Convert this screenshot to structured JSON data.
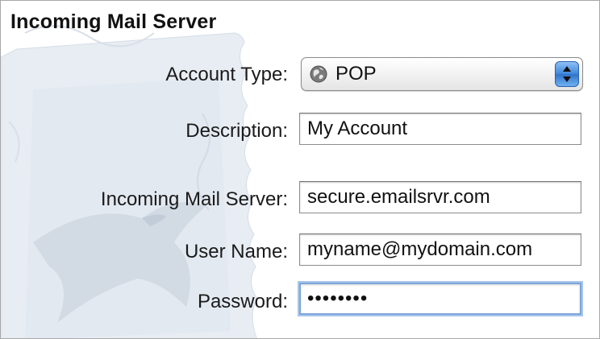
{
  "section": {
    "title": "Incoming Mail Server"
  },
  "form": {
    "account_type": {
      "label": "Account Type:",
      "value": "POP",
      "icon": "globe-icon"
    },
    "description": {
      "label": "Description:",
      "value": "My Account"
    },
    "incoming_server": {
      "label": "Incoming Mail Server:",
      "value": "secure.emailsrvr.com"
    },
    "user_name": {
      "label": "User Name:",
      "value": "myname@mydomain.com"
    },
    "password": {
      "label": "Password:",
      "value": "••••••••"
    }
  },
  "colors": {
    "focus_ring": "#7ea6d8",
    "stepper_blue": "#3e86dc",
    "background_art": "#e9eef4"
  }
}
